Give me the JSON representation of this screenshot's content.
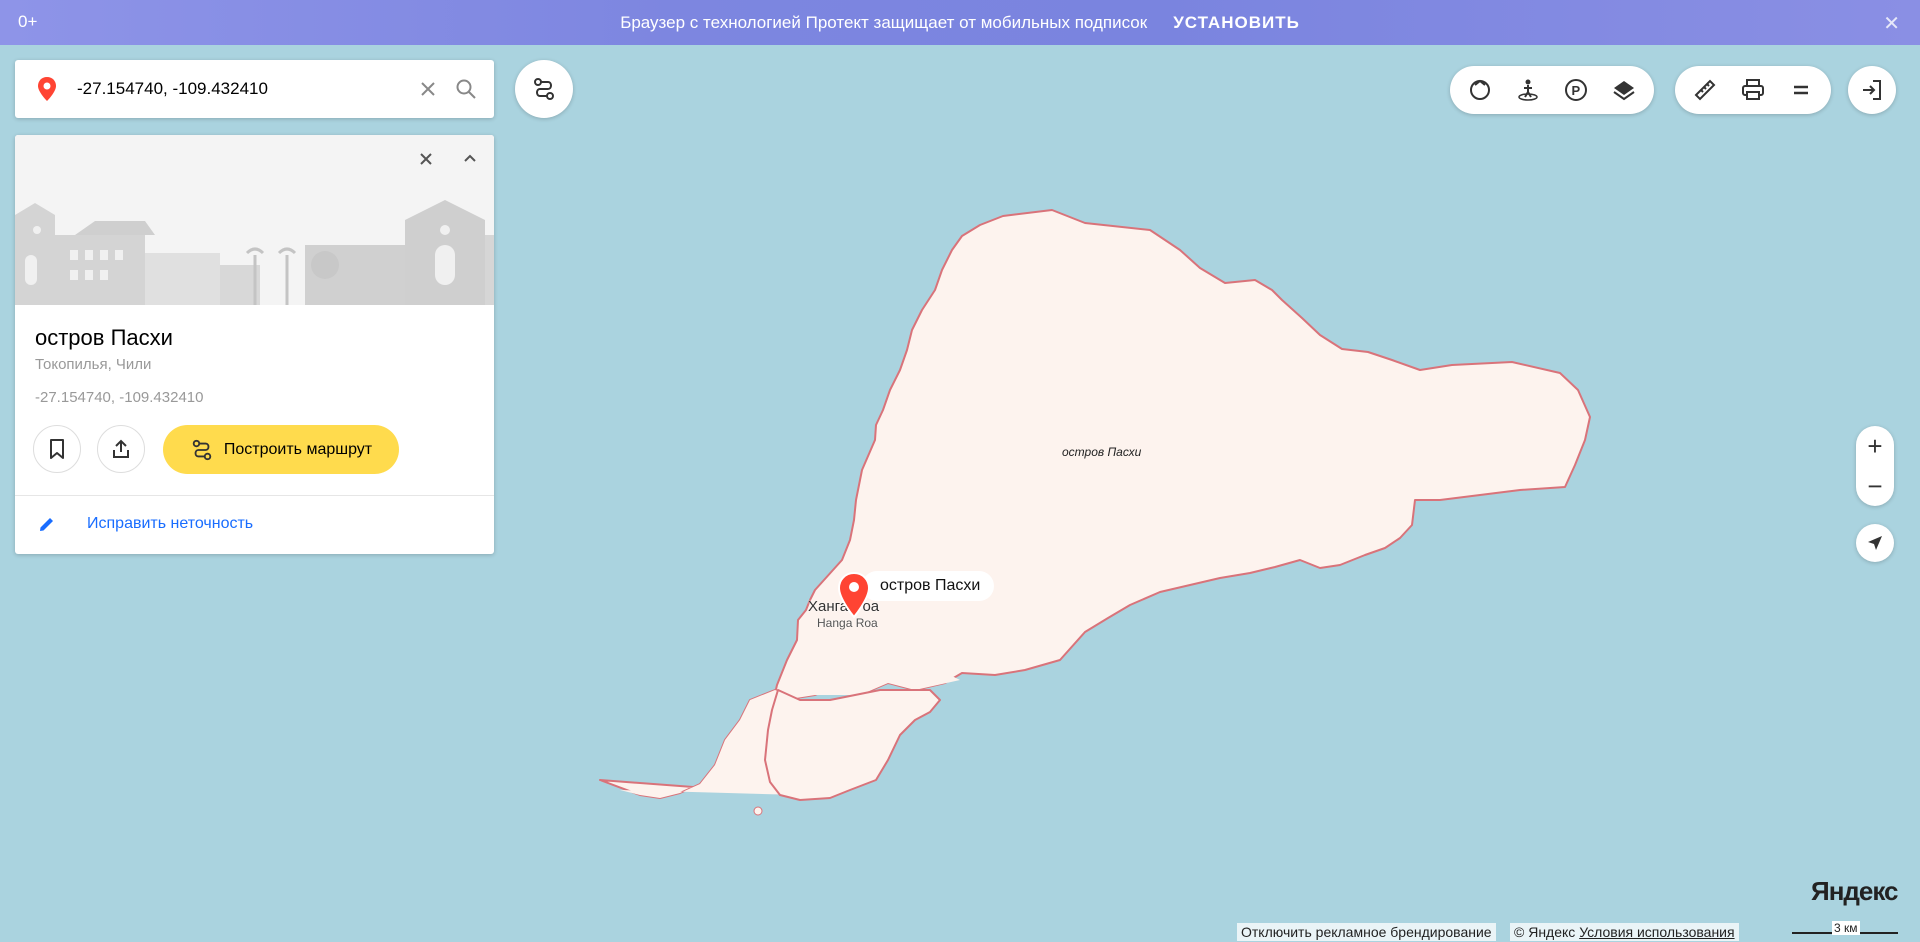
{
  "banner": {
    "age": "0+",
    "message": "Браузер с технологией Протект защищает от мобильных подписок",
    "install_label": "УСТАНОВИТЬ"
  },
  "search": {
    "value": "-27.154740, -109.432410"
  },
  "card": {
    "title": "остров Пасхи",
    "subtitle": "Токопилья, Чили",
    "coordinates": "-27.154740, -109.432410",
    "route_label": "Построить маршрут",
    "fix_label": "Исправить неточность"
  },
  "map": {
    "island_label": "остров Пасхи",
    "town_label": "Ханга-Роа",
    "town_sub_label": "Hanga Roa",
    "pin_label": "остров Пасхи"
  },
  "toolbar": {
    "icons": [
      "traffic-icon",
      "panorama-icon",
      "parking-icon",
      "layers-icon",
      "ruler-icon",
      "print-icon",
      "menu-icon"
    ]
  },
  "footer": {
    "logo": "Яндекс",
    "ad_toggle": "Отключить рекламное брендирование",
    "copyright": "© Яндекс",
    "terms": "Условия использования",
    "scale_label": "3 км"
  },
  "colors": {
    "water": "#aad3df",
    "island_fill": "#fdf3ee",
    "island_border": "#d9737a",
    "accent_yellow": "#ffdb4d",
    "link_blue": "#196dff",
    "pin_red": "#f43"
  }
}
